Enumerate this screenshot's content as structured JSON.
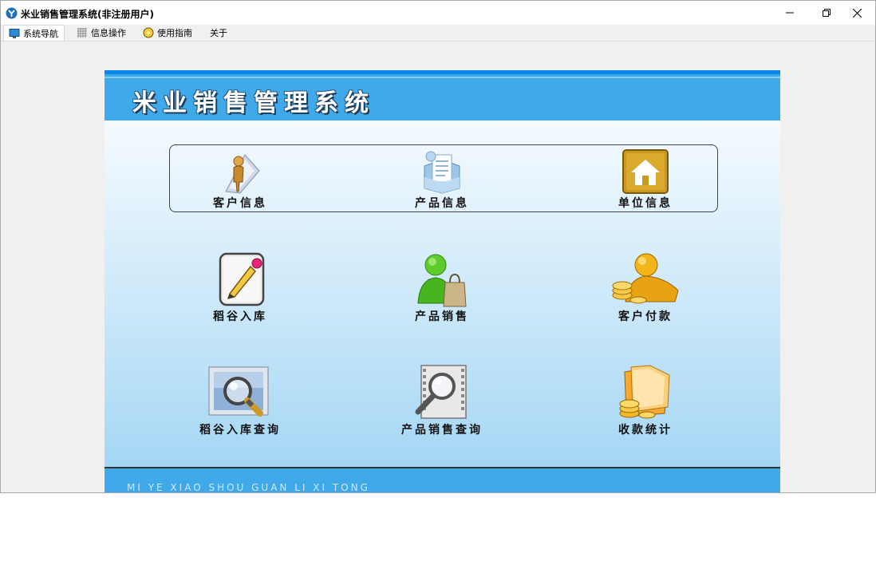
{
  "window": {
    "title": "米业销售管理系统(非注册用户)"
  },
  "menu": {
    "items": [
      {
        "label": "系统导航",
        "icon": "monitor-icon"
      },
      {
        "label": "信息操作",
        "icon": "grid-icon"
      },
      {
        "label": "使用指南",
        "icon": "guide-icon"
      },
      {
        "label": "关于",
        "icon": ""
      }
    ]
  },
  "banner": {
    "title": "米业销售管理系统"
  },
  "tiles": [
    {
      "label": "客户信息",
      "icon": "customer-info-icon"
    },
    {
      "label": "产品信息",
      "icon": "product-info-icon"
    },
    {
      "label": "单位信息",
      "icon": "unit-info-icon"
    },
    {
      "label": "稻谷入库",
      "icon": "grain-inbound-icon"
    },
    {
      "label": "产品销售",
      "icon": "product-sales-icon"
    },
    {
      "label": "客户付款",
      "icon": "customer-payment-icon"
    },
    {
      "label": "稻谷入库查询",
      "icon": "grain-inbound-query-icon"
    },
    {
      "label": "产品销售查询",
      "icon": "product-sales-query-icon"
    },
    {
      "label": "收款统计",
      "icon": "payment-statistics-icon"
    }
  ],
  "footer": {
    "text": "MI YE XIAO SHOU GUAN LI XI TONG"
  },
  "colors": {
    "banner": "#3fa9ea",
    "banner_top": "#0d86e9",
    "accent_gold": "#d9a21a"
  }
}
